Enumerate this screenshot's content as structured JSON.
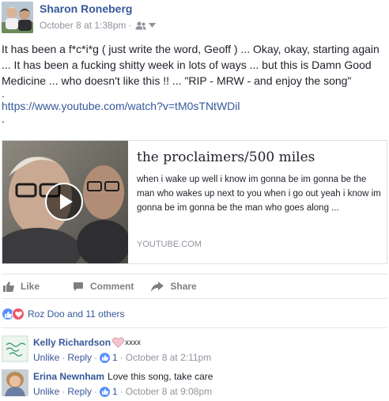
{
  "post": {
    "author": "Sharon Roneberg",
    "timestamp": "October 8 at 1:38pm",
    "separator": "·",
    "privacy_icon": "friends-icon",
    "menu_icon": "chevron-down-icon",
    "text_lines": [
      "It has been a f*c*i*g ( just write the word, Geoff ) ... Okay, okay, starting again",
      "... It has been a fucking shitty week in lots of ways ... but this is Damn Good",
      "Medicine ... who doesn't like this !! ... \"RIP - MRW - and enjoy the song\"",
      "."
    ],
    "link_text": "https://www.youtube.com/watch?v=tM0sTNtWDil",
    "trailing_dot": "."
  },
  "link_card": {
    "title": "the proclaimers/500 miles",
    "description": "when i wake up well i know im gonna be im gonna be the man who wakes up next to you when i go out yeah i know im gonna be im gonna be the man who goes along ...",
    "source": "YOUTUBE.COM",
    "play_icon": "play-icon"
  },
  "actions": {
    "like_label": "Like",
    "comment_label": "Comment",
    "share_label": "Share"
  },
  "reactions": {
    "summary": "Roz Doo and 11 others"
  },
  "comments": [
    {
      "author": "Kelly Richardson",
      "text": "xxxx",
      "unlike": "Unlike",
      "reply": "Reply",
      "likes": "1",
      "time": "October 8 at 2:11pm"
    },
    {
      "author": "Erina Newnham",
      "text": "Love this song, take care",
      "unlike": "Unlike",
      "reply": "Reply",
      "likes": "1",
      "time": "October 8 at 9:08pm"
    }
  ],
  "colors": {
    "link_blue": "#365899",
    "meta_gray": "#90949c",
    "like_blue": "#5890ff",
    "love_red": "#f25268"
  }
}
